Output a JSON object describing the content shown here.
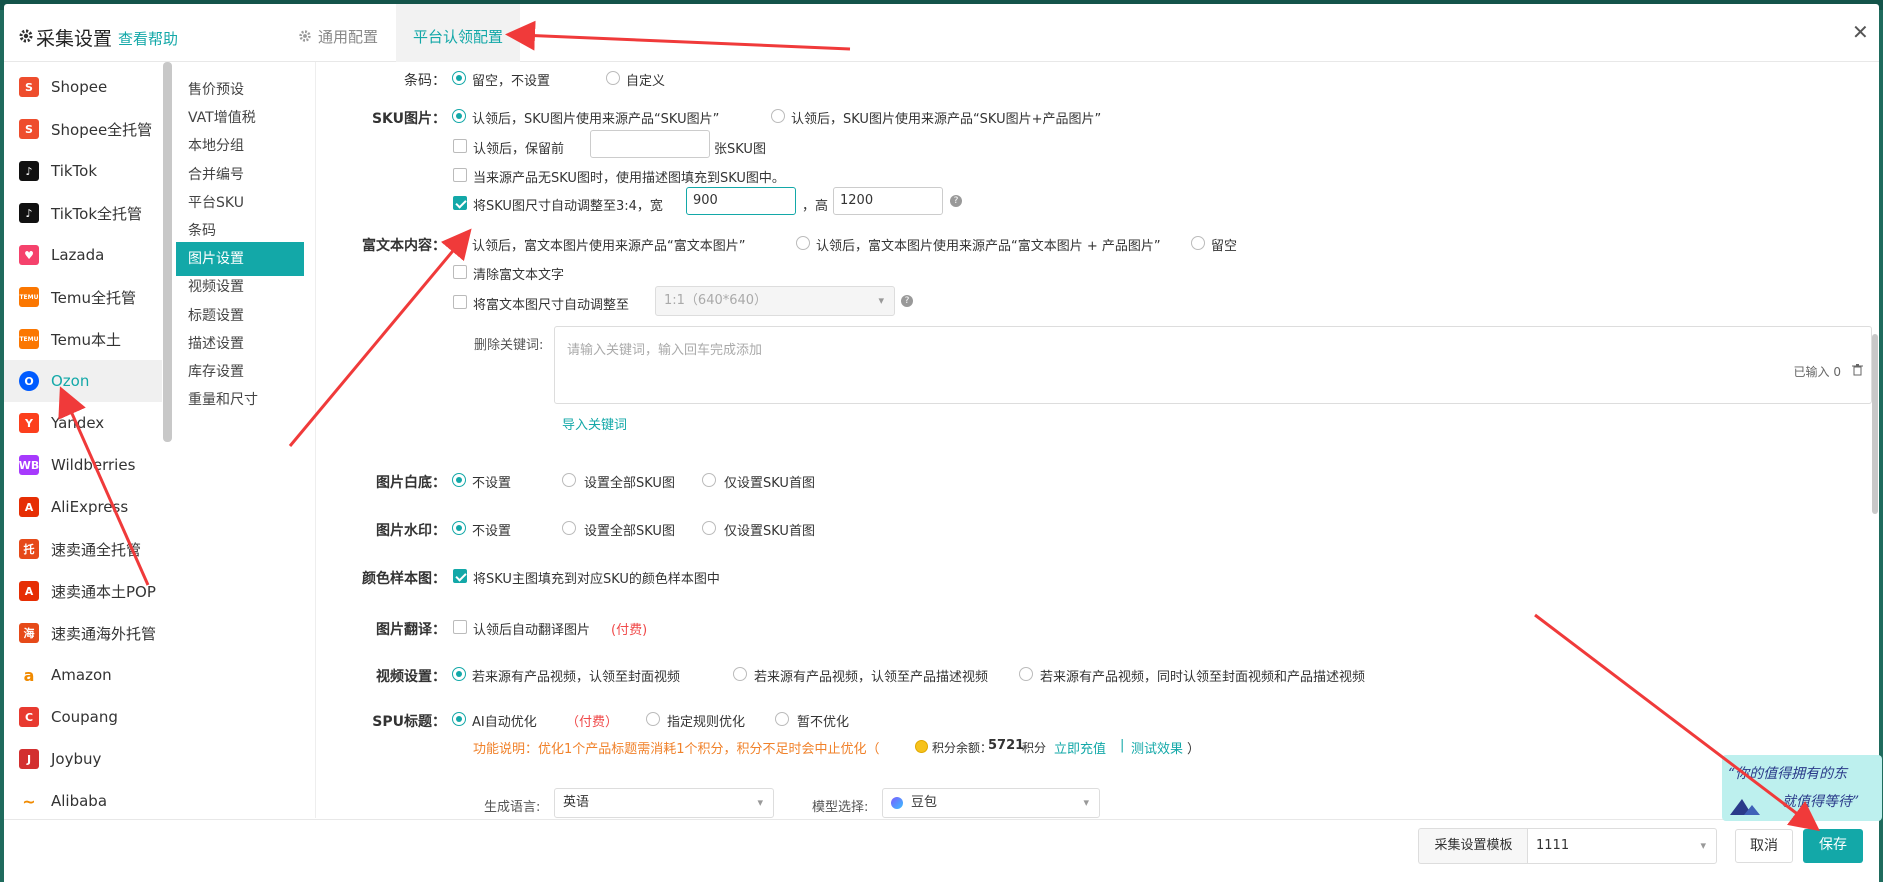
{
  "header": {
    "title": "采集设置",
    "help": "查看帮助",
    "tab_general": "通用配置",
    "tab_platform": "平台认领配置",
    "close": "✕"
  },
  "platforms": [
    {
      "label": "Shopee",
      "icon": "shopee-bag-icon",
      "color": "#ee4d2d",
      "glyph": "S"
    },
    {
      "label": "Shopee全托管",
      "icon": "shopee-bag-icon",
      "color": "#ee4d2d",
      "glyph": "S"
    },
    {
      "label": "TikTok",
      "icon": "tiktok-icon",
      "color": "#111111",
      "glyph": "♪"
    },
    {
      "label": "TikTok全托管",
      "icon": "tiktok-icon",
      "color": "#111111",
      "glyph": "♪"
    },
    {
      "label": "Lazada",
      "icon": "lazada-heart-icon",
      "color": "#f5426c",
      "glyph": "♥"
    },
    {
      "label": "Temu全托管",
      "icon": "temu-icon",
      "color": "#fb7701",
      "glyph": "TEMU"
    },
    {
      "label": "Temu本土",
      "icon": "temu-icon",
      "color": "#fb7701",
      "glyph": "TEMU"
    },
    {
      "label": "Ozon",
      "icon": "ozon-icon",
      "color": "#005bff",
      "glyph": "O"
    },
    {
      "label": "Yandex",
      "icon": "yandex-icon",
      "color": "#fc3f1d",
      "glyph": "Y"
    },
    {
      "label": "Wildberries",
      "icon": "wildberries-icon",
      "color": "#a73afd",
      "glyph": "WB"
    },
    {
      "label": "AliExpress",
      "icon": "aliexpress-icon",
      "color": "#e62e04",
      "glyph": "A"
    },
    {
      "label": "速卖通全托管",
      "icon": "tuo-icon",
      "color": "#e64a19",
      "glyph": "托"
    },
    {
      "label": "速卖通本土POP",
      "icon": "aliexpress-icon",
      "color": "#e62e04",
      "glyph": "A"
    },
    {
      "label": "速卖通海外托管",
      "icon": "hai-icon",
      "color": "#e64a19",
      "glyph": "海"
    },
    {
      "label": "Amazon",
      "icon": "amazon-icon",
      "color": "#ffffff",
      "glyph": "a"
    },
    {
      "label": "Coupang",
      "icon": "coupang-icon",
      "color": "#e83a30",
      "glyph": "C"
    },
    {
      "label": "Joybuy",
      "icon": "joybuy-icon",
      "color": "#d32f2f",
      "glyph": "J"
    },
    {
      "label": "Alibaba",
      "icon": "alibaba-icon",
      "color": "#ffffff",
      "glyph": "~"
    }
  ],
  "menu": [
    "售价预设",
    "VAT增值税",
    "本地分组",
    "合并编号",
    "平台SKU",
    "条码",
    "图片设置",
    "视频设置",
    "标题设置",
    "描述设置",
    "库存设置",
    "重量和尺寸"
  ],
  "barcode": {
    "label": "条码：",
    "opt1": "留空，不设置",
    "opt2": "自定义"
  },
  "sku_image": {
    "label": "SKU图片：",
    "opt1": "认领后，SKU图片使用来源产品“SKU图片”",
    "opt2": "认领后，SKU图片使用来源产品“SKU图片+产品图片”",
    "keep_prefix": "认领后，保留前",
    "keep_suffix": "张SKU图",
    "fill_desc": "当来源产品无SKU图时，使用描述图填充到SKU图中。",
    "resize_text": "将SKU图尺寸自动调整至3:4，宽",
    "width": "900",
    "height_label": "，高",
    "height": "1200"
  },
  "rich_text": {
    "label": "富文本内容：",
    "opt1": "认领后，富文本图片使用来源产品“富文本图片”",
    "opt2": "认领后，富文本图片使用来源产品“富文本图片 + 产品图片”",
    "opt3": "留空",
    "clear": "清除富文本文字",
    "resize": "将富文本图尺寸自动调整至",
    "ratio": "1:1（640*640）",
    "del_kw_label": "删除关键词:",
    "kw_placeholder": "请输入关键词，输入回车完成添加",
    "count": "已输入 0",
    "import": "导入关键词"
  },
  "img_white": {
    "label": "图片白底：",
    "opt1": "不设置",
    "opt2": "设置全部SKU图",
    "opt3": "仅设置SKU首图"
  },
  "img_watermark": {
    "label": "图片水印：",
    "opt1": "不设置",
    "opt2": "设置全部SKU图",
    "opt3": "仅设置SKU首图"
  },
  "color_sample": {
    "label": "颜色样本图：",
    "text": "将SKU主图填充到对应SKU的颜色样本图中"
  },
  "img_translate": {
    "label": "图片翻译：",
    "text": "认领后自动翻译图片",
    "paid": "(付费)"
  },
  "video": {
    "label": "视频设置：",
    "opt1": "若来源有产品视频，认领至封面视频",
    "opt2": "若来源有产品视频，认领至产品描述视频",
    "opt3": "若来源有产品视频，同时认领至封面视频和产品描述视频"
  },
  "spu": {
    "label": "SPU标题：",
    "opt1": "AI自动优化",
    "paid": "（付费）",
    "opt2": "指定规则优化",
    "opt3": "暂不优化",
    "desc": "功能说明：优化1个产品标题需消耗1个积分，积分不足时会中止优化（",
    "points_label": "积分余额：",
    "points": "5721",
    "points_unit": "积分",
    "recharge": "立即充值",
    "sep": "|",
    "test": "测试效果",
    "close_paren": "）",
    "lang_label": "生成语言:",
    "lang": "英语",
    "model_label": "模型选择:",
    "model": "豆包"
  },
  "footer": {
    "template_label": "采集设置模板",
    "template": "1111",
    "cancel": "取消",
    "save": "保存"
  },
  "banner": {
    "line1": "“你的值得拥有的东",
    "line2": "就值得等待”"
  },
  "colors": {
    "accent": "#13a8a8",
    "annotation": "#f03a3a"
  }
}
